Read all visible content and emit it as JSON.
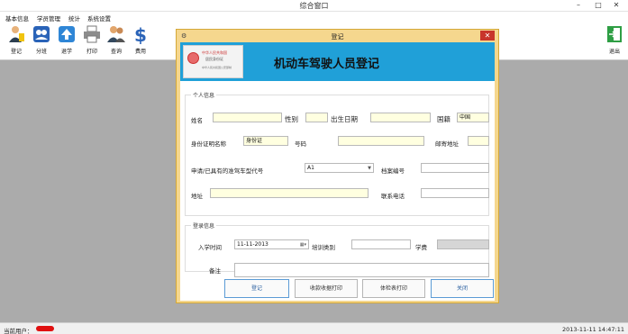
{
  "window": {
    "title": "综合窗口",
    "controls": {
      "minimize": "–",
      "maximize": "□",
      "close": "✕"
    }
  },
  "menu": [
    "基本信息",
    "学员管理",
    "统计",
    "系统设置"
  ],
  "toolbar": {
    "items": [
      {
        "label": "登记",
        "icon": "person-register-icon"
      },
      {
        "label": "分班",
        "icon": "team-icon"
      },
      {
        "label": "退学",
        "icon": "upload-arrow-icon"
      },
      {
        "label": "打印",
        "icon": "printer-icon"
      },
      {
        "label": "查询",
        "icon": "people-search-icon"
      },
      {
        "label": "费用",
        "icon": "dollar-icon"
      }
    ],
    "exit_label": "退出"
  },
  "status": {
    "current_user_label": "当前用户：",
    "datetime": "2013-11-11 14:47:11"
  },
  "dialog": {
    "title": "登记",
    "close": "✕",
    "banner_title": "机动车驾驶人员登记",
    "idcard": {
      "line1": "中华人民共和国",
      "line2": "居民身份证",
      "line3": "中华人民共和国公安部制"
    },
    "personal": {
      "legend": "个人信息",
      "name_label": "姓名",
      "name_value": "",
      "gender_label": "性别",
      "gender_value": "",
      "birth_label": "出生日期",
      "birth_value": "",
      "nationality_label": "国籍",
      "nationality_value": "中国",
      "idtype_label": "身份证明名称",
      "idtype_value": "身份证",
      "idno_label": "号码",
      "idno_value": "",
      "postcode_label": "邮寄地址",
      "postcode_value": "",
      "vehicle_label": "申请/已具有的准驾车型代号",
      "vehicle_value": "A1",
      "archive_label": "档案编号",
      "archive_value": "",
      "address_label": "地址",
      "address_value": "",
      "phone_label": "联系电话",
      "phone_value": ""
    },
    "registration": {
      "legend": "登录信息",
      "enroll_label": "入学时间",
      "enroll_value": "11-11-2013",
      "training_label": "培训类别",
      "training_value": "",
      "fee_label": "学费",
      "fee_value": "",
      "remark_label": "备注",
      "remark_value": ""
    },
    "buttons": {
      "register": "登记",
      "print_receipt": "收款收据打印",
      "print_checkup": "体检表打印",
      "close": "关闭"
    }
  },
  "colors": {
    "banner": "#20a0d8",
    "dialog_frame": "#f5d78e",
    "workspace": "#ababab",
    "close_red": "#c8352b"
  }
}
